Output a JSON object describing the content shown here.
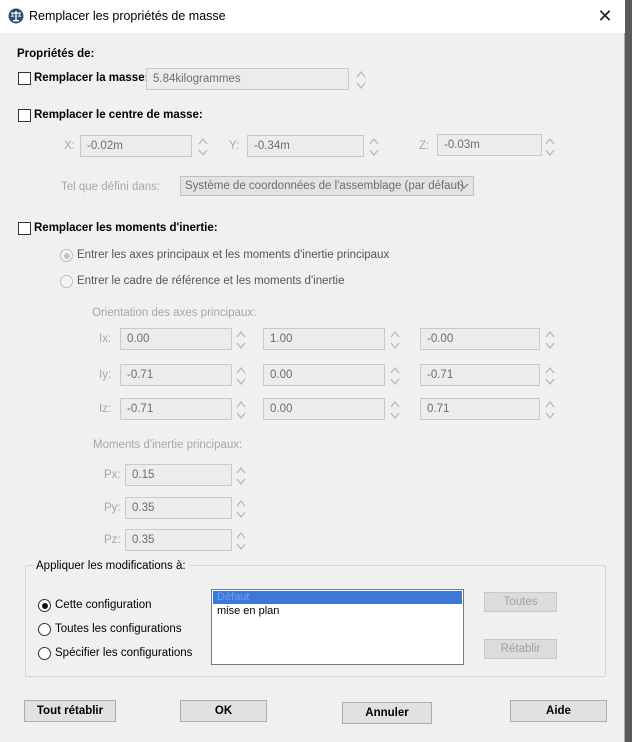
{
  "title": "Remplacer les propriétés de masse",
  "properties_label": "Propriétés de:",
  "mass": {
    "label": "Remplacer la masse:",
    "value": "5.84kilogrammes"
  },
  "center": {
    "label": "Remplacer le centre de masse:",
    "x_label": "X:",
    "x_value": "-0.02m",
    "y_label": "Y:",
    "y_value": "-0.34m",
    "z_label": "Z:",
    "z_value": "-0.03m",
    "defined_label": "Tel que défini dans:",
    "coord_system": "Système de coordonnées de l'assemblage (par défaut)"
  },
  "inertia": {
    "label": "Remplacer les moments d'inertie:",
    "option_principal": "Entrer les axes principaux et les moments d'inertie principaux",
    "option_frame": "Entrer le cadre de référence et les moments d'inertie",
    "orientation_label": "Orientation des axes principaux:",
    "rows": [
      {
        "label": "Ix:",
        "values": [
          "0.00",
          "1.00",
          "-0.00"
        ]
      },
      {
        "label": "Iy:",
        "values": [
          "-0.71",
          "0.00",
          "-0.71"
        ]
      },
      {
        "label": "Iz:",
        "values": [
          "-0.71",
          "0.00",
          "0.71"
        ]
      }
    ],
    "moments_label": "Moments d'inertie principaux:",
    "moments": [
      {
        "label": "Px:",
        "value": "0.15"
      },
      {
        "label": "Py:",
        "value": "0.35"
      },
      {
        "label": "Pz:",
        "value": "0.35"
      }
    ]
  },
  "apply": {
    "label": "Appliquer les modifications à:",
    "options": [
      "Cette configuration",
      "Toutes les configurations",
      "Spécifier les configurations"
    ],
    "configs": [
      "Défaut",
      "mise en plan"
    ],
    "all_button": "Toutes",
    "reset_button": "Rétablir"
  },
  "buttons": {
    "reset_all": "Tout rétablir",
    "ok": "OK",
    "cancel": "Annuler",
    "help": "Aide"
  }
}
